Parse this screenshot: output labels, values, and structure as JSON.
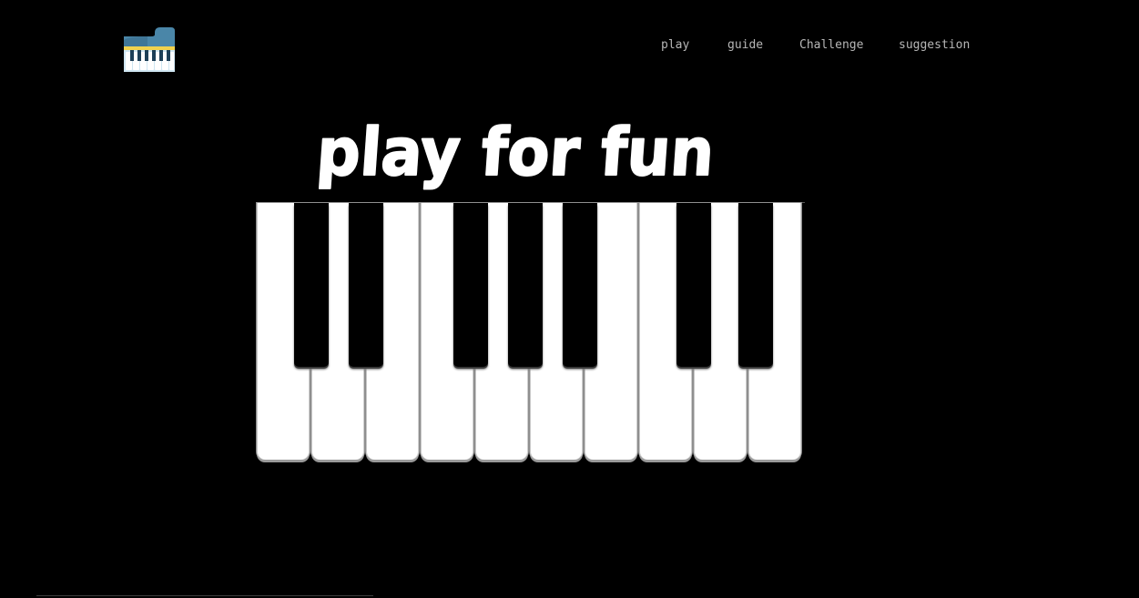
{
  "header": {
    "logo_icon": "piano-icon",
    "nav": [
      {
        "label": "play"
      },
      {
        "label": "guide"
      },
      {
        "label": "Challenge"
      },
      {
        "label": "suggestion"
      }
    ]
  },
  "main": {
    "title": "play for fun"
  },
  "piano": {
    "white_key_count": 10,
    "black_key_count": 7
  },
  "colors": {
    "background": "#000000",
    "nav_text": "#b7b7b7",
    "white_key": "#ffffff",
    "black_key": "#000000",
    "logo_body": "#4a86a8",
    "logo_trim": "#f1d24e"
  }
}
